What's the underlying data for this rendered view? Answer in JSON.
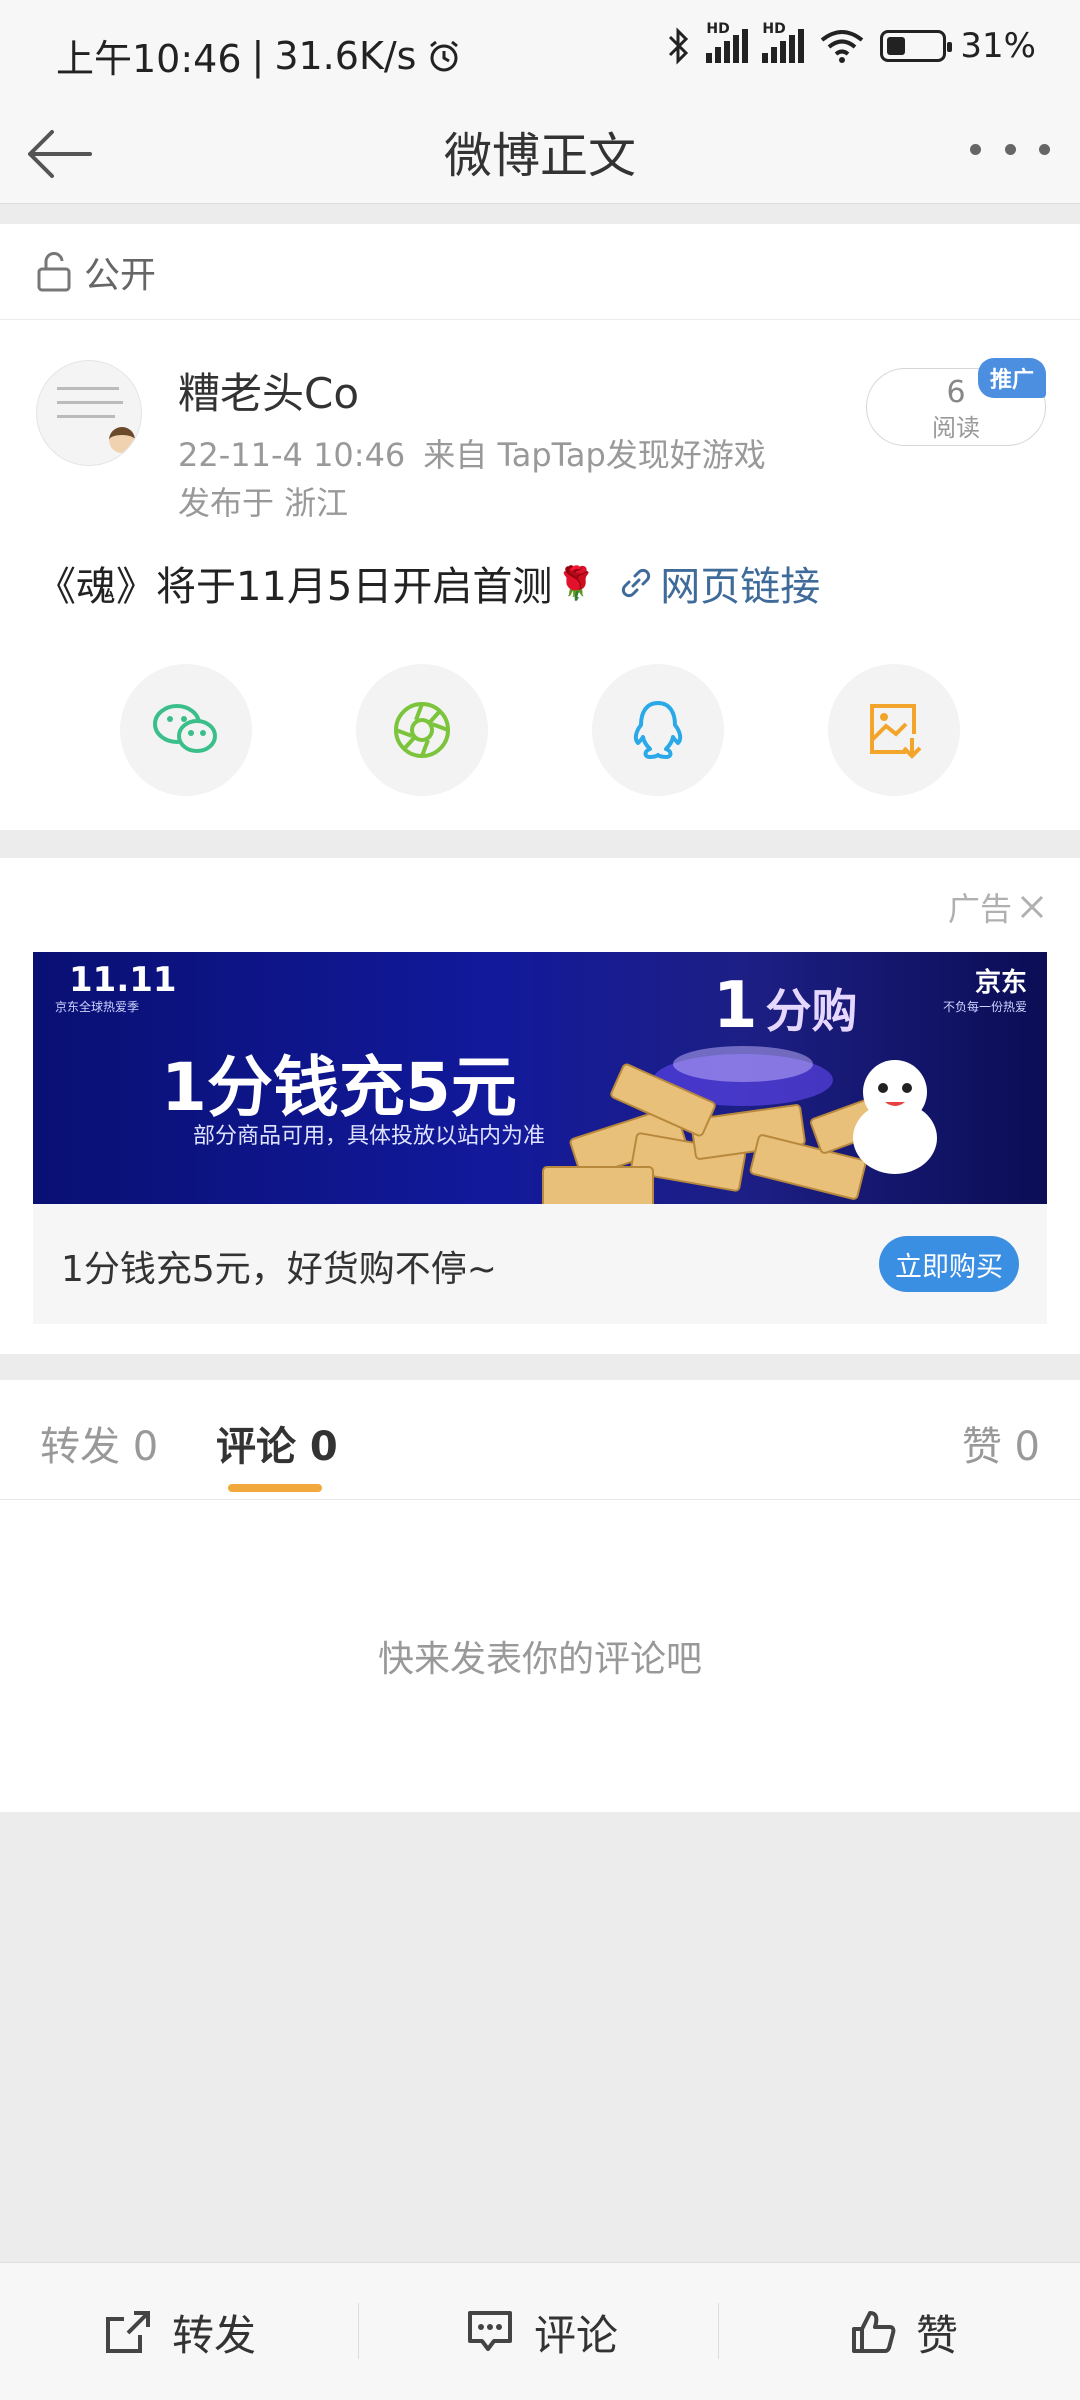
{
  "status_bar": {
    "time": "上午10:46",
    "speed": "31.6K/s",
    "sim1_label": "HD",
    "sim2_label": "HD",
    "battery": "31%"
  },
  "nav": {
    "title": "微博正文"
  },
  "post": {
    "visibility": "公开",
    "username": "糟老头Co",
    "date": "22-11-4 10:46",
    "source": "来自 TapTap发现好游戏",
    "location": "发布于 浙江",
    "read_count": "6",
    "read_label": "阅读",
    "promo_badge": "推广",
    "text": "《魂》将于11月5日开启首测",
    "emoji": "🌹",
    "link_text": "网页链接"
  },
  "share_icons": [
    "wechat-icon",
    "moments-icon",
    "qq-icon",
    "save-image-icon"
  ],
  "ad": {
    "label": "广告",
    "banner_headline": "1分钱充5元",
    "banner_sub": "部分商品可用，具体投放以站内为准",
    "banner_event": "11.11",
    "banner_event_sub": "京东全球热爱季",
    "banner_brand": "京东",
    "banner_brand_sub": "不负每一份热爱",
    "banner_promo_1": "1",
    "banner_promo_2": "分购",
    "caption": "1分钱充5元，好货购不停~",
    "cta": "立即购买"
  },
  "tabs": {
    "repost": "转发 0",
    "comment": "评论 0",
    "like": "赞 0"
  },
  "comments": {
    "empty_text": "快来发表你的评论吧"
  },
  "toolbar": {
    "repost": "转发",
    "comment": "评论",
    "like": "赞"
  },
  "colors": {
    "link": "#3f6b9a",
    "tab_underline": "#f2a83a",
    "cta": "#3b8fe2",
    "wechat": "#3bbf8a",
    "moments": "#7bc43c",
    "qq": "#2ba8e8",
    "save": "#f2a52a"
  }
}
